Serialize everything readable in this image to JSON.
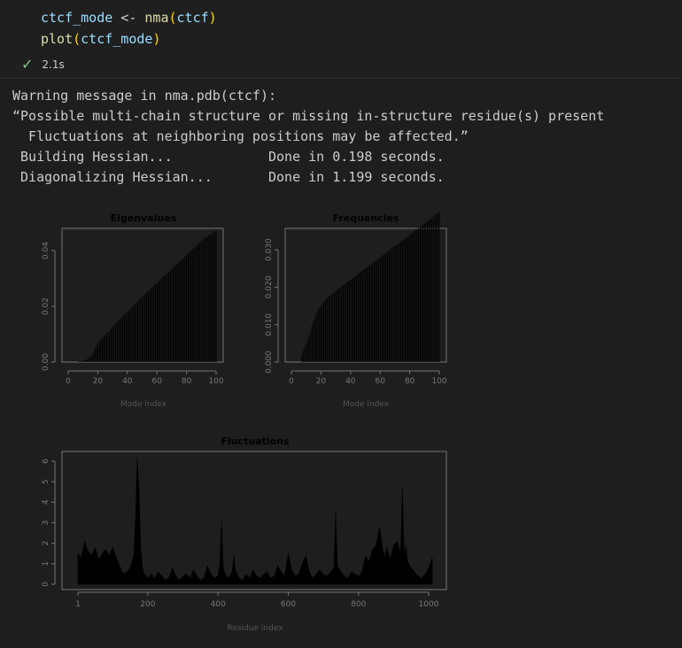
{
  "cell": {
    "code_lines": [
      {
        "var": "ctcf_mode",
        "op": " <- ",
        "fn": "nma",
        "arg": "ctcf"
      },
      {
        "fn": "plot",
        "arg": "ctcf_mode"
      }
    ],
    "exec_time": "2.1s"
  },
  "output": {
    "lines": [
      "Warning message in nma.pdb(ctcf):",
      "“Possible multi-chain structure or missing in-structure residue(s) present",
      "  Fluctuations at neighboring positions may be affected.”",
      " Building Hessian...            Done in 0.198 seconds.",
      " Diagonalizing Hessian...       Done in 1.199 seconds."
    ]
  },
  "chart_data": [
    {
      "type": "bar",
      "title": "Eigenvalues",
      "xlabel": "Mode index",
      "ylabel": "",
      "xlim": [
        0,
        100
      ],
      "ylim": [
        0,
        0.047
      ],
      "xticks": [
        0,
        20,
        40,
        60,
        80,
        100
      ],
      "yticks": [
        0.0,
        0.02,
        0.04
      ],
      "ytick_labels": [
        "0.00",
        "0.02",
        "0.04"
      ],
      "x": [
        7,
        8,
        9,
        10,
        11,
        12,
        13,
        14,
        15,
        16,
        17,
        18,
        19,
        20,
        21,
        22,
        23,
        24,
        25,
        26,
        27,
        28,
        29,
        30,
        31,
        32,
        33,
        34,
        35,
        36,
        37,
        38,
        39,
        40,
        41,
        42,
        43,
        44,
        45,
        46,
        47,
        48,
        49,
        50,
        51,
        52,
        53,
        54,
        55,
        56,
        57,
        58,
        59,
        60,
        61,
        62,
        63,
        64,
        65,
        66,
        67,
        68,
        69,
        70,
        71,
        72,
        73,
        74,
        75,
        76,
        77,
        78,
        79,
        80,
        81,
        82,
        83,
        84,
        85,
        86,
        87,
        88,
        89,
        90,
        91,
        92,
        93,
        94,
        95,
        96,
        97,
        98,
        99,
        100
      ],
      "values": [
        0.0002,
        0.0003,
        0.0004,
        0.0005,
        0.0007,
        0.0008,
        0.0011,
        0.0014,
        0.0018,
        0.0022,
        0.0034,
        0.005,
        0.0058,
        0.0066,
        0.0073,
        0.008,
        0.0086,
        0.0092,
        0.0097,
        0.0102,
        0.0108,
        0.0113,
        0.0119,
        0.0125,
        0.0131,
        0.0137,
        0.0143,
        0.0149,
        0.0155,
        0.016,
        0.0165,
        0.017,
        0.0175,
        0.018,
        0.0185,
        0.019,
        0.0195,
        0.02,
        0.0206,
        0.0212,
        0.0218,
        0.0224,
        0.0229,
        0.0234,
        0.0239,
        0.0244,
        0.0249,
        0.0254,
        0.0259,
        0.0264,
        0.0269,
        0.0274,
        0.0279,
        0.0284,
        0.0289,
        0.0294,
        0.0299,
        0.0304,
        0.0309,
        0.0314,
        0.0319,
        0.0324,
        0.0329,
        0.0334,
        0.0339,
        0.0344,
        0.0349,
        0.0354,
        0.0359,
        0.0364,
        0.0369,
        0.0374,
        0.0379,
        0.0384,
        0.0389,
        0.0394,
        0.0399,
        0.0404,
        0.0409,
        0.0414,
        0.0419,
        0.0424,
        0.0429,
        0.0434,
        0.0439,
        0.0443,
        0.0447,
        0.0451,
        0.0455,
        0.0459,
        0.0462,
        0.0465,
        0.0468,
        0.0471
      ]
    },
    {
      "type": "bar",
      "title": "Frequencies",
      "xlabel": "Mode index",
      "ylabel": "",
      "xlim": [
        0,
        100
      ],
      "ylim": [
        0,
        0.035
      ],
      "xticks": [
        0,
        20,
        40,
        60,
        80,
        100
      ],
      "yticks": [
        0.0,
        0.01,
        0.02,
        0.03
      ],
      "ytick_labels": [
        "0.000",
        "0.010",
        "0.020",
        "0.030"
      ],
      "x": [
        7,
        8,
        9,
        10,
        11,
        12,
        13,
        14,
        15,
        16,
        17,
        18,
        19,
        20,
        21,
        22,
        23,
        24,
        25,
        26,
        27,
        28,
        29,
        30,
        31,
        32,
        33,
        34,
        35,
        36,
        37,
        38,
        39,
        40,
        41,
        42,
        43,
        44,
        45,
        46,
        47,
        48,
        49,
        50,
        51,
        52,
        53,
        54,
        55,
        56,
        57,
        58,
        59,
        60,
        61,
        62,
        63,
        64,
        65,
        66,
        67,
        68,
        69,
        70,
        71,
        72,
        73,
        74,
        75,
        76,
        77,
        78,
        79,
        80,
        81,
        82,
        83,
        84,
        85,
        86,
        87,
        88,
        89,
        90,
        91,
        92,
        93,
        94,
        95,
        96,
        97,
        98,
        99,
        100
      ],
      "values": [
        0.002,
        0.003,
        0.004,
        0.005,
        0.006,
        0.007,
        0.0085,
        0.01,
        0.011,
        0.012,
        0.013,
        0.014,
        0.0145,
        0.015,
        0.0155,
        0.016,
        0.0165,
        0.017,
        0.0175,
        0.0178,
        0.0181,
        0.0184,
        0.0187,
        0.019,
        0.0193,
        0.0196,
        0.0199,
        0.0202,
        0.0205,
        0.0208,
        0.0211,
        0.0214,
        0.0217,
        0.022,
        0.0223,
        0.0226,
        0.0229,
        0.0232,
        0.0235,
        0.0238,
        0.0241,
        0.0244,
        0.0247,
        0.025,
        0.0253,
        0.0256,
        0.0259,
        0.0262,
        0.0265,
        0.0268,
        0.0271,
        0.0274,
        0.0277,
        0.028,
        0.0283,
        0.0286,
        0.0289,
        0.0292,
        0.0295,
        0.0298,
        0.0301,
        0.0304,
        0.0307,
        0.031,
        0.0313,
        0.0316,
        0.0319,
        0.0322,
        0.0325,
        0.0328,
        0.0331,
        0.0334,
        0.0337,
        0.034,
        0.0343,
        0.0346,
        0.0349,
        0.0352,
        0.0355,
        0.0358,
        0.0361,
        0.0364,
        0.0367,
        0.037,
        0.0373,
        0.0376,
        0.0379,
        0.0382,
        0.0385,
        0.0388,
        0.0391,
        0.0394,
        0.0397,
        0.04
      ]
    },
    {
      "type": "area",
      "title": "Fluctuations",
      "xlabel": "Residue index",
      "ylabel": "",
      "xlim": [
        1,
        1010
      ],
      "ylim": [
        0,
        6.3
      ],
      "xticks": [
        1,
        200,
        400,
        600,
        800,
        1000
      ],
      "yticks": [
        0,
        1,
        2,
        3,
        4,
        5,
        6
      ],
      "x": [
        1,
        10,
        20,
        30,
        40,
        50,
        60,
        70,
        80,
        90,
        100,
        110,
        120,
        130,
        140,
        150,
        160,
        165,
        170,
        175,
        180,
        185,
        190,
        200,
        210,
        220,
        230,
        240,
        250,
        260,
        270,
        280,
        290,
        300,
        310,
        320,
        330,
        340,
        350,
        360,
        370,
        380,
        390,
        400,
        405,
        410,
        415,
        420,
        430,
        440,
        445,
        450,
        460,
        470,
        480,
        490,
        500,
        510,
        520,
        530,
        540,
        550,
        560,
        570,
        580,
        590,
        600,
        610,
        620,
        630,
        640,
        650,
        660,
        670,
        680,
        690,
        700,
        710,
        720,
        730,
        735,
        740,
        750,
        760,
        770,
        780,
        790,
        800,
        810,
        820,
        830,
        840,
        850,
        860,
        870,
        875,
        880,
        890,
        900,
        910,
        920,
        925,
        930,
        935,
        940,
        950,
        960,
        970,
        980,
        990,
        1000,
        1010
      ],
      "values": [
        1.5,
        1.3,
        2.1,
        1.6,
        1.4,
        1.8,
        1.2,
        1.5,
        1.7,
        1.4,
        1.8,
        1.3,
        0.9,
        0.5,
        0.6,
        0.8,
        1.4,
        3.2,
        6.2,
        4.5,
        1.8,
        0.8,
        0.5,
        0.3,
        0.5,
        0.3,
        0.6,
        0.4,
        0.2,
        0.3,
        0.8,
        0.4,
        0.2,
        0.4,
        0.5,
        0.3,
        0.7,
        0.4,
        0.2,
        0.3,
        0.9,
        0.5,
        0.3,
        0.4,
        1.0,
        3.1,
        0.8,
        0.5,
        0.3,
        0.6,
        1.4,
        0.7,
        0.3,
        0.2,
        0.5,
        0.3,
        0.7,
        0.4,
        0.3,
        0.5,
        0.6,
        0.3,
        0.4,
        0.9,
        0.6,
        0.4,
        1.5,
        0.7,
        0.4,
        0.5,
        1.0,
        1.4,
        0.6,
        0.3,
        0.5,
        0.7,
        0.5,
        0.4,
        0.6,
        0.8,
        3.5,
        0.9,
        0.6,
        0.4,
        0.3,
        0.6,
        0.5,
        0.4,
        0.6,
        1.4,
        1.1,
        1.7,
        1.9,
        2.8,
        1.6,
        1.3,
        1.8,
        1.2,
        1.9,
        2.1,
        1.5,
        4.7,
        1.4,
        1.9,
        1.1,
        0.8,
        0.6,
        0.4,
        0.3,
        0.5,
        0.8,
        1.3
      ]
    }
  ]
}
